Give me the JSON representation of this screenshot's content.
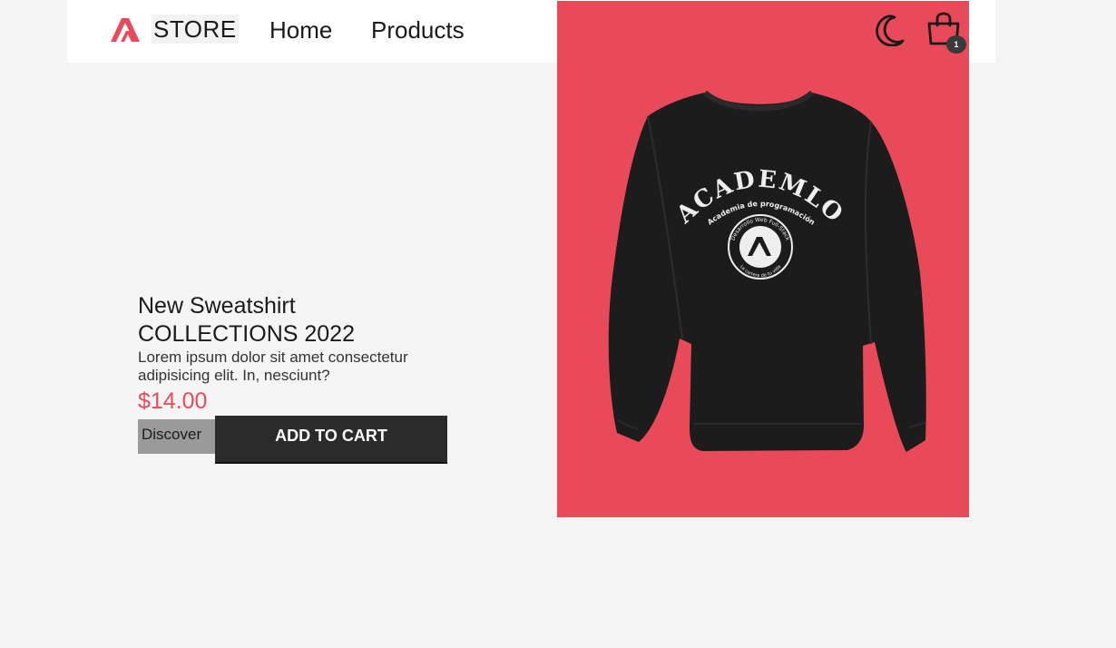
{
  "header": {
    "logo_text": "STORE",
    "nav": {
      "home": "Home",
      "products": "Products"
    },
    "icons": {
      "logo": "academlo-logo-icon",
      "theme": "moon-icon",
      "cart": "shopping-bag-icon"
    },
    "cart_count": "1"
  },
  "hero": {
    "title_line1": "New Sweatshirt",
    "title_line2": "COLLECTIONS 2022",
    "description": "Lorem ipsum dolor sit amet consectetur adipisicing elit. In, nesciunt?",
    "price": "$14.00",
    "discover_label": "Discover",
    "add_to_cart_label": "ADD TO CART",
    "product_print": {
      "brand": "ACADEMLO",
      "tagline": "Academia de programación",
      "badge_top": "Desarrollo Web Full-Stack",
      "badge_bottom": "La carrera de tu vida"
    }
  },
  "colors": {
    "accent": "#e94a5a",
    "page_background": "#f5f5f5",
    "header_background": "#ffffff",
    "button_dark": "#2b2b2b",
    "button_gray": "#9a9a9a",
    "product": "#1c1c1c"
  }
}
